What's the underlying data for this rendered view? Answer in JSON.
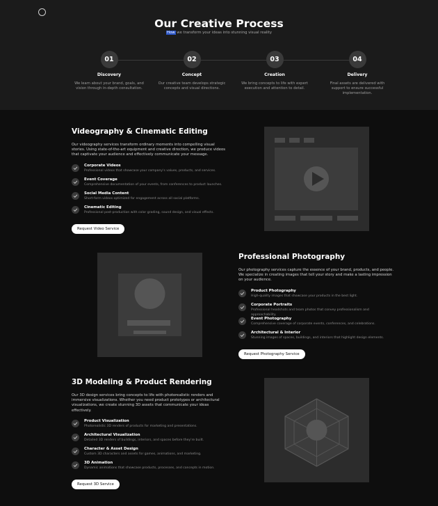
{
  "process": {
    "title": "Our Creative Process",
    "subtitle_highlight": "How",
    "subtitle_rest": " we transform your ideas into stunning visual reality",
    "steps": [
      {
        "num": "01",
        "title": "Discovery",
        "desc": "We learn about your brand, goals, and vision through in-depth consultation."
      },
      {
        "num": "02",
        "title": "Concept",
        "desc": "Our creative team develops strategic concepts and visual directions."
      },
      {
        "num": "03",
        "title": "Creation",
        "desc": "We bring concepts to life with expert execution and attention to detail."
      },
      {
        "num": "04",
        "title": "Delivery",
        "desc": "Final assets are delivered with support to ensure successful implementation."
      }
    ]
  },
  "services": {
    "video": {
      "title": "Videography & Cinematic Editing",
      "intro": "Our videography services transform ordinary moments into compelling visual stories. Using state-of-the-art equipment and creative direction, we produce videos that captivate your audience and effectively communicate your message.",
      "features": [
        {
          "title": "Corporate Videos",
          "desc": "Professional videos that showcase your company's values, products, and services."
        },
        {
          "title": "Event Coverage",
          "desc": "Comprehensive documentation of your events, from conferences to product launches."
        },
        {
          "title": "Social Media Content",
          "desc": "Short-form videos optimized for engagement across all social platforms."
        },
        {
          "title": "Cinematic Editing",
          "desc": "Professional post-production with color grading, sound design, and visual effects."
        }
      ],
      "button": "Request Video Service"
    },
    "photo": {
      "title": "Professional Photography",
      "intro": "Our photography services capture the essence of your brand, products, and people. We specialize in creating images that tell your story and make a lasting impression on your audience.",
      "features": [
        {
          "title": "Product Photography",
          "desc": "High-quality images that showcase your products in the best light."
        },
        {
          "title": "Corporate Portraits",
          "desc": "Professional headshots and team photos that convey professionalism and approachability."
        },
        {
          "title": "Event Photography",
          "desc": "Comprehensive coverage of corporate events, conferences, and celebrations."
        },
        {
          "title": "Architectural & Interior",
          "desc": "Stunning images of spaces, buildings, and interiors that highlight design elements."
        }
      ],
      "button": "Request Photography Service"
    },
    "modeling": {
      "title": "3D Modeling & Product Rendering",
      "intro": "Our 3D design services bring concepts to life with photorealistic renders and immersive visualizations. Whether you need product prototypes or architectural visualizations, we create stunning 3D assets that communicate your ideas effectively.",
      "features": [
        {
          "title": "Product Visualization",
          "desc": "Photorealistic 3D renders of products for marketing and presentations."
        },
        {
          "title": "Architectural Visualization",
          "desc": "Detailed 3D renders of buildings, interiors, and spaces before they're built."
        },
        {
          "title": "Character & Asset Design",
          "desc": "Custom 3D characters and assets for games, animations, and marketing."
        },
        {
          "title": "3D Animation",
          "desc": "Dynamic animations that showcase products, processes, and concepts in motion."
        }
      ],
      "button": "Request 3D Service"
    }
  }
}
